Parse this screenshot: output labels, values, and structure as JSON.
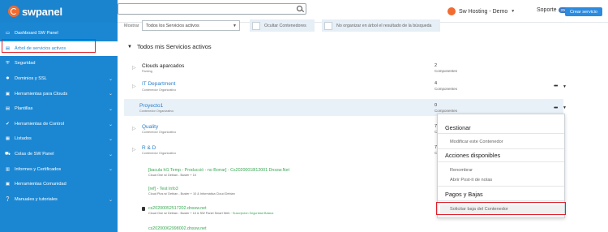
{
  "brand": {
    "name": "swpanel"
  },
  "sidebar": {
    "items": [
      {
        "label": "Dashboard SW Panel",
        "icon": "dashboard-icon",
        "chevron": false
      },
      {
        "label": "Árbol de servicios activos",
        "icon": "tree-icon",
        "chevron": false
      },
      {
        "label": "Seguridad",
        "icon": "shield-icon",
        "chevron": false
      },
      {
        "label": "Dominios y SSL",
        "icon": "gear-icon",
        "chevron": true
      },
      {
        "label": "Herramientas para Clouds",
        "icon": "briefcase-icon",
        "chevron": true
      },
      {
        "label": "Plantillas",
        "icon": "document-icon",
        "chevron": true
      },
      {
        "label": "Herramientas de Control",
        "icon": "check-circle-icon",
        "chevron": true
      },
      {
        "label": "Listados",
        "icon": "list-icon",
        "chevron": true
      },
      {
        "label": "Colas de SW Panel",
        "icon": "queue-icon",
        "chevron": true
      },
      {
        "label": "Informes y Certificados",
        "icon": "report-icon",
        "chevron": true
      },
      {
        "label": "Herramientas Comunidad",
        "icon": "community-icon",
        "chevron": false
      },
      {
        "label": "Manuales y tutoriales",
        "icon": "help-icon",
        "chevron": true
      }
    ]
  },
  "topbar": {
    "account": "Sw Hosting - Demo",
    "support": "Soporte",
    "support_badge": "200",
    "create_button": "Crear servicio"
  },
  "filters": {
    "show_label": "Mostrar",
    "select_value": "Todos los Servicios activos",
    "hide_containers": "Ocultar Contenedores",
    "no_tree": "No organizar en árbol el resultado de la búsqueda"
  },
  "section": {
    "title": "Todos mis Servicios activos"
  },
  "rows": [
    {
      "title": "Clouds aparcados",
      "subtitle": "Parking",
      "count": "2",
      "count_label": "Componentes"
    },
    {
      "title": "IT Department",
      "subtitle": "Contenedor Organizativo",
      "count": "4",
      "count_label": "Componentes"
    },
    {
      "title": "Proyecto1",
      "subtitle": "Contenedor Organizativo",
      "count": "0",
      "count_label": "Componentes"
    },
    {
      "title": "Quality",
      "subtitle": "Contenedor Organizativo",
      "count": "7",
      "count_label": "C"
    },
    {
      "title": "R & D",
      "subtitle": "Contenedor Organizativo",
      "count": "7",
      "count_label": "C"
    }
  ],
  "services": [
    {
      "title": "[bacula hl1 Temp - Producció - no Borrar] - Cs20200018l12001.Dnssw.Net",
      "subtitle": "Cloud One w/ Debian - Buster + 10",
      "extra": ""
    },
    {
      "title": "[ref] - Test Info3",
      "subtitle": "Cloud Plus w/ Debian - Buster + 10 & Informática Cloud Debian",
      "extra": ""
    },
    {
      "title": "cs20200052517202.dnssw.net",
      "subtitle": "Cloud One w/ Debian - Buster + 10 & SW Panel Smart Web · ",
      "extra": "Suscripción Seguridad Básica"
    },
    {
      "title": "cs20200062998002.dnssw.net",
      "subtitle": "",
      "extra": ""
    }
  ],
  "menu": {
    "group1": "Gestionar",
    "modify": "Modificar este Contenedor",
    "group2": "Acciones disponibles",
    "rename": "Renombrar",
    "postit": "Abrir Post-it de notas",
    "group3": "Pagos y Bajas",
    "request_drop": "Solicitar baja del Contenedor"
  },
  "colors": {
    "sidebar": "#1b87d3",
    "accent": "#f26b2f",
    "green_link": "#39a853",
    "highlight": "#e0202a"
  }
}
